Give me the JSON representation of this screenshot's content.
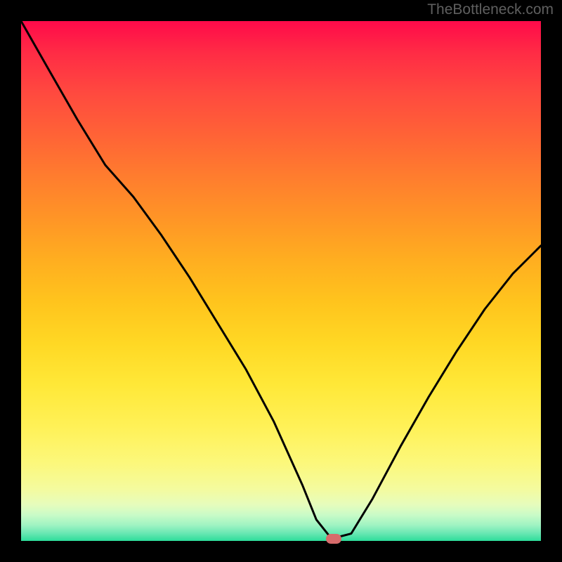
{
  "watermark": "TheBottleneck.com",
  "chart_data": {
    "type": "line",
    "title": "",
    "xlabel": "",
    "ylabel": "",
    "xlim": [
      0,
      100
    ],
    "ylim": [
      0,
      100
    ],
    "grid": false,
    "legend": false,
    "background_gradient": {
      "stops": [
        {
          "pos": 0,
          "color": "#ff0a4a"
        },
        {
          "pos": 14,
          "color": "#ff4a3f"
        },
        {
          "pos": 30,
          "color": "#ff7d2e"
        },
        {
          "pos": 46,
          "color": "#ffae20"
        },
        {
          "pos": 62,
          "color": "#ffd824"
        },
        {
          "pos": 78,
          "color": "#fff157"
        },
        {
          "pos": 90,
          "color": "#f4fb9e"
        },
        {
          "pos": 97,
          "color": "#9ef3c2"
        },
        {
          "pos": 100,
          "color": "#2ddc9a"
        }
      ]
    },
    "series": [
      {
        "name": "bottleneck-curve",
        "color": "#000000",
        "x": [
          0.0,
          5.4,
          10.8,
          16.2,
          21.6,
          27.0,
          32.4,
          37.8,
          43.2,
          48.6,
          54.1,
          56.8,
          59.5,
          60.8,
          63.5,
          67.6,
          73.0,
          78.4,
          83.8,
          89.2,
          94.6,
          100.0
        ],
        "y": [
          100.0,
          90.5,
          81.1,
          72.3,
          66.2,
          58.8,
          50.7,
          41.9,
          33.1,
          23.0,
          10.8,
          4.1,
          0.7,
          0.7,
          1.4,
          8.1,
          18.2,
          27.7,
          36.5,
          44.6,
          51.4,
          56.8
        ]
      }
    ],
    "marker": {
      "x": 60.1,
      "y": 0.4,
      "color": "#d76b6b"
    }
  }
}
